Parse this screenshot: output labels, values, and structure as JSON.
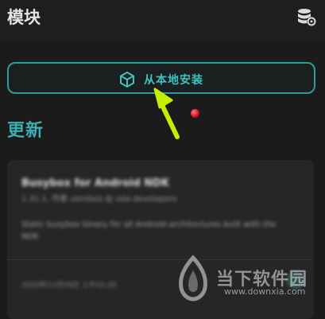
{
  "header": {
    "title": "模块",
    "action_icon": "database-settings-icon"
  },
  "install_button": {
    "label": "从本地安装",
    "icon": "package-box-icon"
  },
  "section": {
    "title": "更新"
  },
  "module_card": {
    "name": "Busybox for Android NDK",
    "meta": "1.31.1, 作者 osm0sis @ xda-developers",
    "description": "Static busybox binary for all Android architectures built with the NDK",
    "date": "2020年11月09日 上午02:26"
  },
  "watermark": {
    "text": "当下软件园",
    "url": "www.downxia.com",
    "icon": "downxia-logo-icon"
  },
  "colors": {
    "accent": "#3fc3bd",
    "background": "#1b1b1b",
    "arrow": "#c4f000",
    "dot": "#c40012"
  }
}
